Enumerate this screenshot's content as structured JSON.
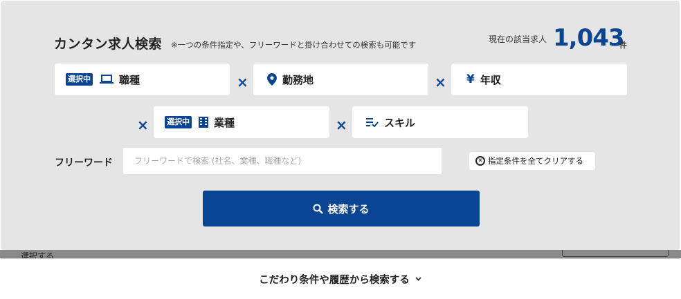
{
  "header": {
    "title": "カンタン求人検索",
    "subtitle": "※一つの条件指定や、フリーワードと掛け合わせての検索も可能です",
    "count_label": "現在の該当求人",
    "count_value": "1,043",
    "count_unit": "件"
  },
  "filters": {
    "selected_badge": "選択中",
    "occupation": "職種",
    "location": "勤務地",
    "salary": "年収",
    "yen_symbol": "¥",
    "industry": "業種",
    "skill": "スキル",
    "times_symbol": "×"
  },
  "freeword": {
    "label": "フリーワード",
    "placeholder": "フリーワードで検索 (社名、業種、職種など)",
    "value": ""
  },
  "clear_button": {
    "label": "指定条件を全てクリアする"
  },
  "search_button": {
    "label": "検索する"
  },
  "behind": {
    "text": "選択する"
  },
  "bottom": {
    "label": "こだわり条件や履歴から検索する"
  },
  "colors": {
    "accent": "#0a4593",
    "panel_bg": "#e5e5e5"
  }
}
